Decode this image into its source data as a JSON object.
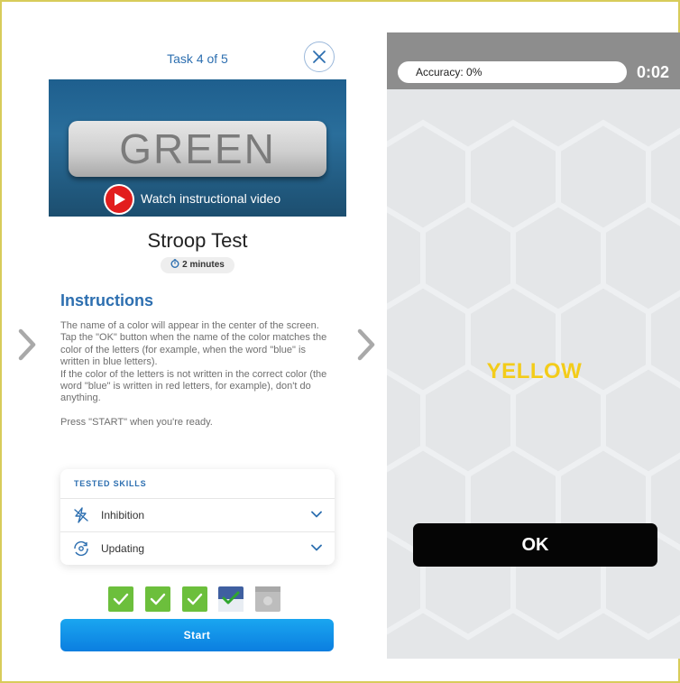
{
  "left_panel": {
    "task_counter": "Task 4 of 5",
    "video": {
      "word": "GREEN",
      "caption": "Watch instructional video"
    },
    "test_title": "Stroop Test",
    "duration": "2 minutes",
    "instructions": {
      "heading": "Instructions",
      "paragraph1": "The name of a color will appear in the center of the screen.",
      "paragraph2": "Tap the \"OK\" button when the name of the color matches the color of the letters (for example, when the word \"blue\" is written in blue letters).",
      "paragraph3": "If the color of the letters is not written in the correct color (the word \"blue\" is written in red letters, for example), don't do anything.",
      "paragraph4": "Press \"START\" when you're ready."
    },
    "tested_skills": {
      "title": "TESTED SKILLS",
      "items": [
        {
          "label": "Inhibition",
          "icon": "lightning-icon"
        },
        {
          "label": "Updating",
          "icon": "refresh-eye-icon"
        }
      ]
    },
    "task_progress": [
      "completed",
      "completed",
      "completed",
      "current",
      "locked"
    ],
    "start_label": "Start"
  },
  "game_panel": {
    "accuracy": "Accuracy: 0%",
    "timer": "0:02",
    "stimulus_word": "YELLOW",
    "stimulus_color": "#f3cc1a",
    "ok_label": "OK"
  },
  "colors": {
    "accent_blue": "#2d6fb0",
    "success_green": "#6cbf3c",
    "start_button": "#0b7ee0"
  }
}
